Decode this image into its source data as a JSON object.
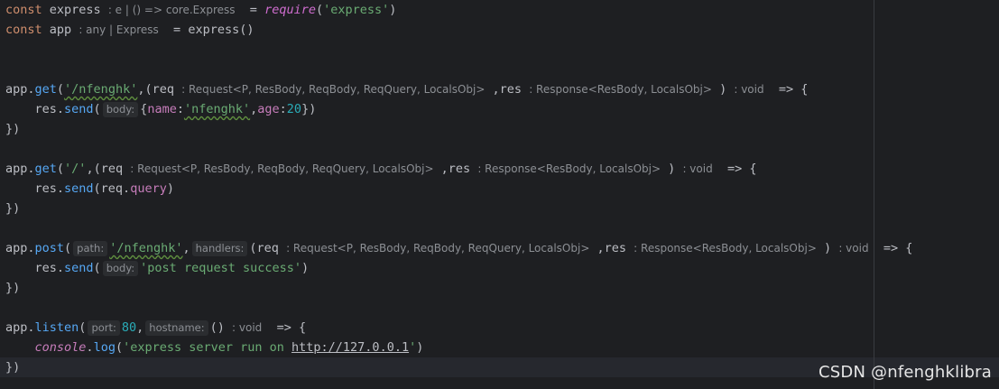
{
  "code": {
    "l1": {
      "kw": "const",
      "name": "express",
      "hint": ": e | () => core.Express",
      "eq": "=",
      "fn": "require",
      "arg": "'express'"
    },
    "l2": {
      "kw": "const",
      "name": "app",
      "hint": ": any | Express",
      "eq": "=",
      "rhs": "express()"
    },
    "l5": {
      "obj": "app.",
      "method": "get",
      "open": "(",
      "path": "'/nfenghk'",
      "mid": ",(req",
      "req_hint": ": Request<P, ResBody, ReqBody, ReqQuery, LocalsObj>",
      "res": " ,res",
      "res_hint": ": Response<ResBody, LocalsObj>",
      "close": ")",
      "ret_hint": ": void",
      "arrow": "=> {"
    },
    "l6": {
      "call": "res.",
      "method": "send",
      "open": "(",
      "hint": "body:",
      "obj_open": "{",
      "k1": "name",
      "colon1": ":",
      "v1": "'nfenghk'",
      "comma": ",",
      "k2": "age",
      "colon2": ":",
      "v2": "20",
      "close": "})"
    },
    "l7": {
      "text": "})"
    },
    "l9": {
      "obj": "app.",
      "method": "get",
      "open": "(",
      "path": "'/'",
      "mid": ",(req",
      "req_hint": ": Request<P, ResBody, ReqBody, ReqQuery, LocalsObj>",
      "res": " ,res",
      "res_hint": ": Response<ResBody, LocalsObj>",
      "close": ")",
      "ret_hint": ": void",
      "arrow": "=> {"
    },
    "l10": {
      "call": "res.",
      "method": "send",
      "arg_open": "(req.",
      "prop": "query",
      "close": ")"
    },
    "l11": {
      "text": "})"
    },
    "l13": {
      "obj": "app.",
      "method": "post",
      "open": "(",
      "path_hint": "path:",
      "path": "'/nfenghk'",
      "comma": ",",
      "handlers_hint": "handlers:",
      "mid": "(req",
      "req_hint": ": Request<P, ResBody, ReqBody, ReqQuery, LocalsObj>",
      "res": " ,res",
      "res_hint": ": Response<ResBody, LocalsObj>",
      "close": ")",
      "ret_hint": ": void",
      "arrow": "=> {"
    },
    "l14": {
      "call": "res.",
      "method": "send",
      "open": "(",
      "hint": "body:",
      "arg": "'post request success'",
      "close": ")"
    },
    "l15": {
      "text": "})"
    },
    "l17": {
      "obj": "app.",
      "method": "listen",
      "open": "(",
      "port_hint": "port:",
      "port": "80",
      "comma": ",",
      "host_hint": "hostname:",
      "fn": "()",
      "ret_hint": ": void",
      "arrow": "=> {"
    },
    "l18": {
      "console": "console",
      "dot": ".",
      "method": "log",
      "open": "(",
      "str_start": "'express server run on ",
      "url": "http://127.0.0.1",
      "str_end": "'",
      "close": ")"
    },
    "l19": {
      "text": "})"
    }
  },
  "watermark": "CSDN @nfenghklibra",
  "colors": {
    "background": "#1e1f22",
    "keyword": "#cf8e6d",
    "string": "#6aab73",
    "function": "#56a8f5",
    "number": "#2aacb8",
    "property": "#c77dbb",
    "hint": "#8c8f94"
  }
}
